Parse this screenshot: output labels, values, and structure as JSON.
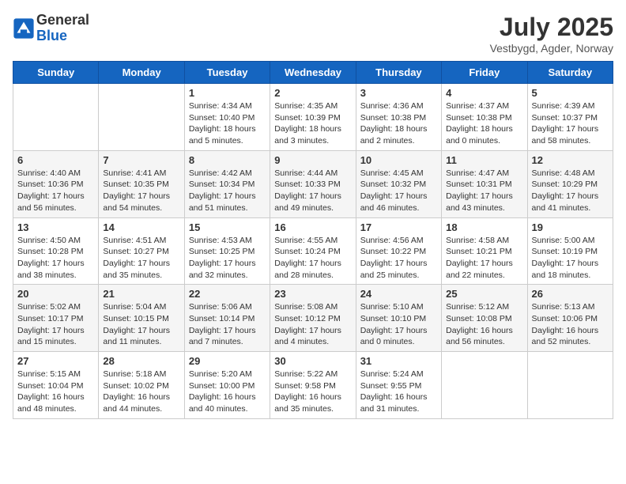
{
  "header": {
    "logo_text_general": "General",
    "logo_text_blue": "Blue",
    "month_title": "July 2025",
    "subtitle": "Vestbygd, Agder, Norway"
  },
  "days_of_week": [
    "Sunday",
    "Monday",
    "Tuesday",
    "Wednesday",
    "Thursday",
    "Friday",
    "Saturday"
  ],
  "weeks": [
    [
      {
        "day": "",
        "info": ""
      },
      {
        "day": "",
        "info": ""
      },
      {
        "day": "1",
        "info": "Sunrise: 4:34 AM\nSunset: 10:40 PM\nDaylight: 18 hours and 5 minutes."
      },
      {
        "day": "2",
        "info": "Sunrise: 4:35 AM\nSunset: 10:39 PM\nDaylight: 18 hours and 3 minutes."
      },
      {
        "day": "3",
        "info": "Sunrise: 4:36 AM\nSunset: 10:38 PM\nDaylight: 18 hours and 2 minutes."
      },
      {
        "day": "4",
        "info": "Sunrise: 4:37 AM\nSunset: 10:38 PM\nDaylight: 18 hours and 0 minutes."
      },
      {
        "day": "5",
        "info": "Sunrise: 4:39 AM\nSunset: 10:37 PM\nDaylight: 17 hours and 58 minutes."
      }
    ],
    [
      {
        "day": "6",
        "info": "Sunrise: 4:40 AM\nSunset: 10:36 PM\nDaylight: 17 hours and 56 minutes."
      },
      {
        "day": "7",
        "info": "Sunrise: 4:41 AM\nSunset: 10:35 PM\nDaylight: 17 hours and 54 minutes."
      },
      {
        "day": "8",
        "info": "Sunrise: 4:42 AM\nSunset: 10:34 PM\nDaylight: 17 hours and 51 minutes."
      },
      {
        "day": "9",
        "info": "Sunrise: 4:44 AM\nSunset: 10:33 PM\nDaylight: 17 hours and 49 minutes."
      },
      {
        "day": "10",
        "info": "Sunrise: 4:45 AM\nSunset: 10:32 PM\nDaylight: 17 hours and 46 minutes."
      },
      {
        "day": "11",
        "info": "Sunrise: 4:47 AM\nSunset: 10:31 PM\nDaylight: 17 hours and 43 minutes."
      },
      {
        "day": "12",
        "info": "Sunrise: 4:48 AM\nSunset: 10:29 PM\nDaylight: 17 hours and 41 minutes."
      }
    ],
    [
      {
        "day": "13",
        "info": "Sunrise: 4:50 AM\nSunset: 10:28 PM\nDaylight: 17 hours and 38 minutes."
      },
      {
        "day": "14",
        "info": "Sunrise: 4:51 AM\nSunset: 10:27 PM\nDaylight: 17 hours and 35 minutes."
      },
      {
        "day": "15",
        "info": "Sunrise: 4:53 AM\nSunset: 10:25 PM\nDaylight: 17 hours and 32 minutes."
      },
      {
        "day": "16",
        "info": "Sunrise: 4:55 AM\nSunset: 10:24 PM\nDaylight: 17 hours and 28 minutes."
      },
      {
        "day": "17",
        "info": "Sunrise: 4:56 AM\nSunset: 10:22 PM\nDaylight: 17 hours and 25 minutes."
      },
      {
        "day": "18",
        "info": "Sunrise: 4:58 AM\nSunset: 10:21 PM\nDaylight: 17 hours and 22 minutes."
      },
      {
        "day": "19",
        "info": "Sunrise: 5:00 AM\nSunset: 10:19 PM\nDaylight: 17 hours and 18 minutes."
      }
    ],
    [
      {
        "day": "20",
        "info": "Sunrise: 5:02 AM\nSunset: 10:17 PM\nDaylight: 17 hours and 15 minutes."
      },
      {
        "day": "21",
        "info": "Sunrise: 5:04 AM\nSunset: 10:15 PM\nDaylight: 17 hours and 11 minutes."
      },
      {
        "day": "22",
        "info": "Sunrise: 5:06 AM\nSunset: 10:14 PM\nDaylight: 17 hours and 7 minutes."
      },
      {
        "day": "23",
        "info": "Sunrise: 5:08 AM\nSunset: 10:12 PM\nDaylight: 17 hours and 4 minutes."
      },
      {
        "day": "24",
        "info": "Sunrise: 5:10 AM\nSunset: 10:10 PM\nDaylight: 17 hours and 0 minutes."
      },
      {
        "day": "25",
        "info": "Sunrise: 5:12 AM\nSunset: 10:08 PM\nDaylight: 16 hours and 56 minutes."
      },
      {
        "day": "26",
        "info": "Sunrise: 5:13 AM\nSunset: 10:06 PM\nDaylight: 16 hours and 52 minutes."
      }
    ],
    [
      {
        "day": "27",
        "info": "Sunrise: 5:15 AM\nSunset: 10:04 PM\nDaylight: 16 hours and 48 minutes."
      },
      {
        "day": "28",
        "info": "Sunrise: 5:18 AM\nSunset: 10:02 PM\nDaylight: 16 hours and 44 minutes."
      },
      {
        "day": "29",
        "info": "Sunrise: 5:20 AM\nSunset: 10:00 PM\nDaylight: 16 hours and 40 minutes."
      },
      {
        "day": "30",
        "info": "Sunrise: 5:22 AM\nSunset: 9:58 PM\nDaylight: 16 hours and 35 minutes."
      },
      {
        "day": "31",
        "info": "Sunrise: 5:24 AM\nSunset: 9:55 PM\nDaylight: 16 hours and 31 minutes."
      },
      {
        "day": "",
        "info": ""
      },
      {
        "day": "",
        "info": ""
      }
    ]
  ]
}
